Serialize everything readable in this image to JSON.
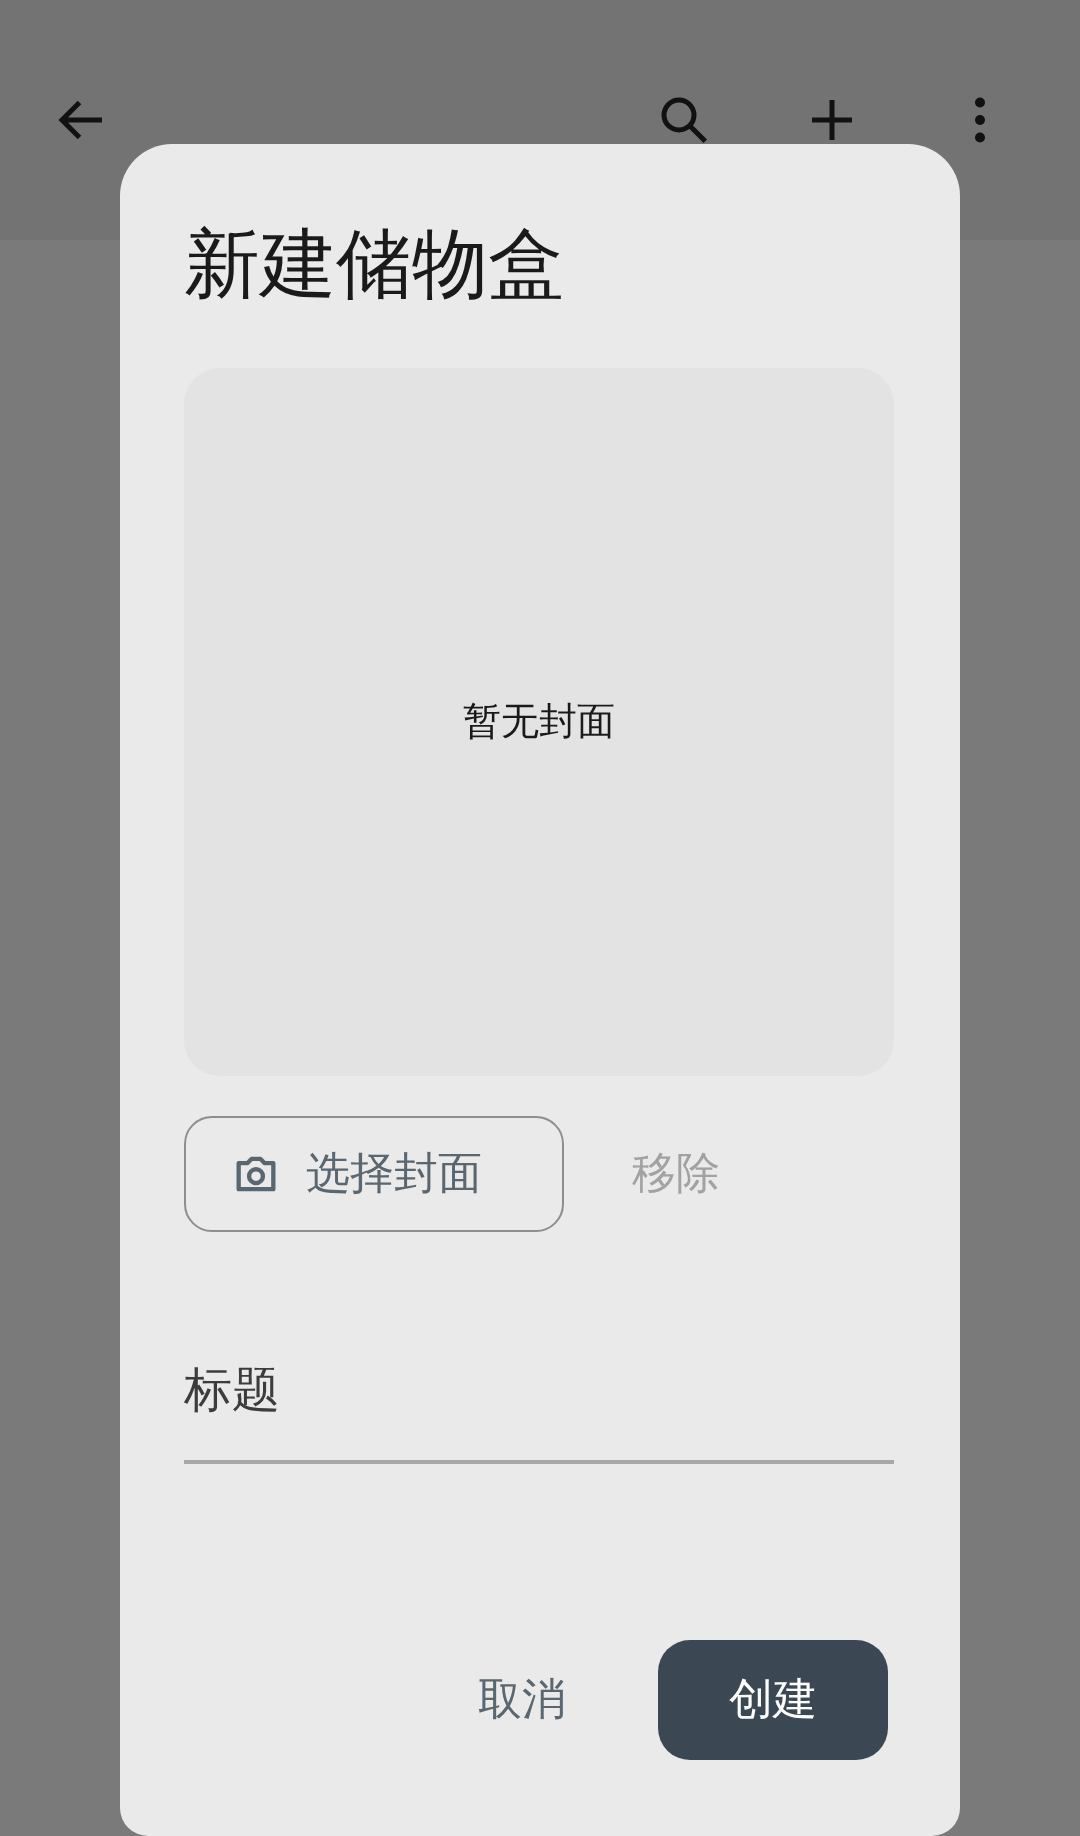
{
  "dialog": {
    "title": "新建储物盒",
    "cover": {
      "empty_text": "暂无封面"
    },
    "choose_button": {
      "label": "选择封面"
    },
    "remove_button": {
      "label": "移除",
      "disabled": true
    },
    "title_field": {
      "placeholder": "标题"
    },
    "buttons": [
      {
        "label": "取消",
        "kind": "text"
      },
      {
        "label": "创建",
        "kind": "filled"
      }
    ]
  }
}
